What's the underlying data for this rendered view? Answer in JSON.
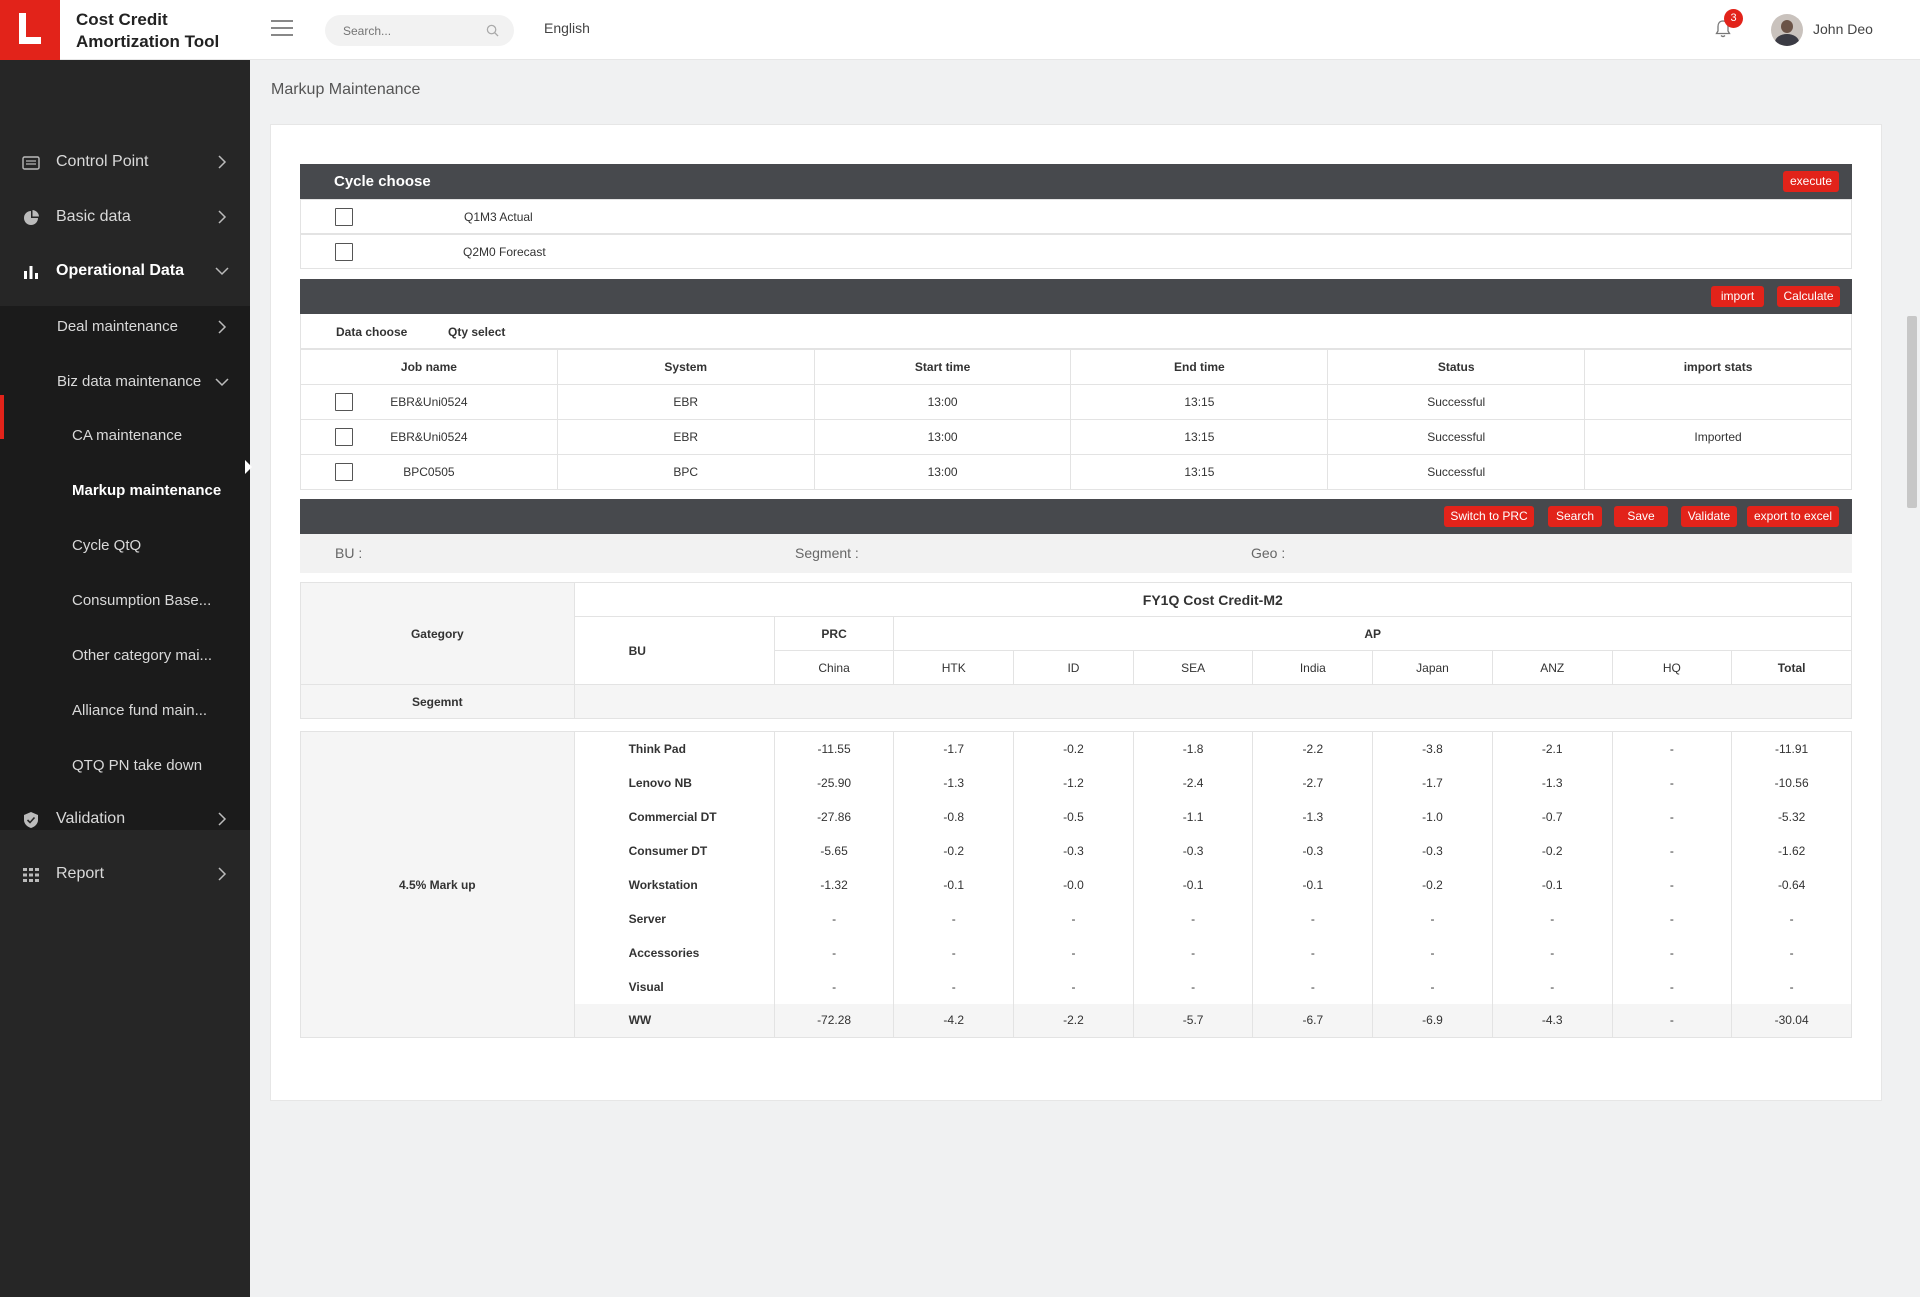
{
  "app": {
    "title": "Cost Credit Amortization Tool",
    "language": "English",
    "notification_count": "3",
    "user_name": "John Deo",
    "search_placeholder": "Search..."
  },
  "sidebar": {
    "items": [
      {
        "label": "Control Point",
        "icon": "table-icon"
      },
      {
        "label": "Basic data",
        "icon": "pie-chart-icon"
      },
      {
        "label": "Operational Data",
        "icon": "bar-chart-icon"
      },
      {
        "label": "Validation",
        "icon": "shield-icon"
      },
      {
        "label": "Report",
        "icon": "grid-icon"
      }
    ],
    "sub_items": [
      {
        "label": "Deal maintenance"
      },
      {
        "label": "Biz data maintenance"
      }
    ],
    "subsub_items": [
      {
        "label": "CA maintenance"
      },
      {
        "label": "Markup maintenance"
      },
      {
        "label": "Cycle QtQ"
      },
      {
        "label": "Consumption Base..."
      },
      {
        "label": "Other category mai..."
      },
      {
        "label": "Alliance fund main..."
      },
      {
        "label": "QTQ PN take down"
      }
    ]
  },
  "page": {
    "title": "Markup Maintenance"
  },
  "cycle": {
    "header": "Cycle choose",
    "execute_label": "execute",
    "options": [
      "Q1M3 Actual",
      "Q2M0 Forecast"
    ]
  },
  "jobs": {
    "import_label": "import",
    "calculate_label": "Calculate",
    "tabs": [
      "Data choose",
      "Qty select"
    ],
    "columns": [
      "Job name",
      "System",
      "Start time",
      "End time",
      "Status",
      "import stats"
    ],
    "rows": [
      [
        "EBR&Uni0524",
        "EBR",
        "13:00",
        "13:15",
        "Successful",
        ""
      ],
      [
        "EBR&Uni0524",
        "EBR",
        "13:00",
        "13:15",
        "Successful",
        "Imported"
      ],
      [
        "BPC0505",
        "BPC",
        "13:00",
        "13:15",
        "Successful",
        ""
      ]
    ]
  },
  "actions": {
    "switch_label": "Switch to PRC",
    "search_label": "Search",
    "save_label": "Save",
    "validate_label": "Validate",
    "export_label": "export to excel"
  },
  "filters": {
    "bu": "BU :",
    "segment": "Segment :",
    "geo": "Geo :"
  },
  "matrix": {
    "title": "FY1Q Cost Credit-M2",
    "category_label": "Gategory",
    "segment_label": "Segemnt",
    "bu_label": "BU",
    "prc_label": "PRC",
    "ap_label": "AP",
    "geos": [
      "China",
      "HTK",
      "ID",
      "SEA",
      "India",
      "Japan",
      "ANZ",
      "HQ",
      "Total"
    ],
    "category": "4.5% Mark up",
    "rows": [
      {
        "name": "Think Pad",
        "values": [
          "-11.55",
          "-1.7",
          "-0.2",
          "-1.8",
          "-2.2",
          "-3.8",
          "-2.1",
          "-",
          "-11.91"
        ]
      },
      {
        "name": "Lenovo NB",
        "values": [
          "-25.90",
          "-1.3",
          "-1.2",
          "-2.4",
          "-2.7",
          "-1.7",
          "-1.3",
          "-",
          "-10.56"
        ]
      },
      {
        "name": "Commercial DT",
        "values": [
          "-27.86",
          "-0.8",
          "-0.5",
          "-1.1",
          "-1.3",
          "-1.0",
          "-0.7",
          "-",
          "-5.32"
        ]
      },
      {
        "name": "Consumer DT",
        "values": [
          "-5.65",
          "-0.2",
          "-0.3",
          "-0.3",
          "-0.3",
          "-0.3",
          "-0.2",
          "-",
          "-1.62"
        ]
      },
      {
        "name": "Workstation",
        "values": [
          "-1.32",
          "-0.1",
          "-0.0",
          "-0.1",
          "-0.1",
          "-0.2",
          "-0.1",
          "-",
          "-0.64"
        ]
      },
      {
        "name": "Server",
        "values": [
          "-",
          "-",
          "-",
          "-",
          "-",
          "-",
          "-",
          "-",
          "-"
        ]
      },
      {
        "name": "Accessories",
        "values": [
          "-",
          "-",
          "-",
          "-",
          "-",
          "-",
          "-",
          "-",
          "-"
        ]
      },
      {
        "name": "Visual",
        "values": [
          "-",
          "-",
          "-",
          "-",
          "-",
          "-",
          "-",
          "-",
          "-"
        ]
      },
      {
        "name": "WW",
        "values": [
          "-72.28",
          "-4.2",
          "-2.2",
          "-5.7",
          "-6.7",
          "-6.9",
          "-4.3",
          "-",
          "-30.04"
        ]
      }
    ]
  },
  "colors": {
    "accent": "#e2231a",
    "sidebar_bg": "#262626",
    "dark_bar": "#47494d"
  }
}
